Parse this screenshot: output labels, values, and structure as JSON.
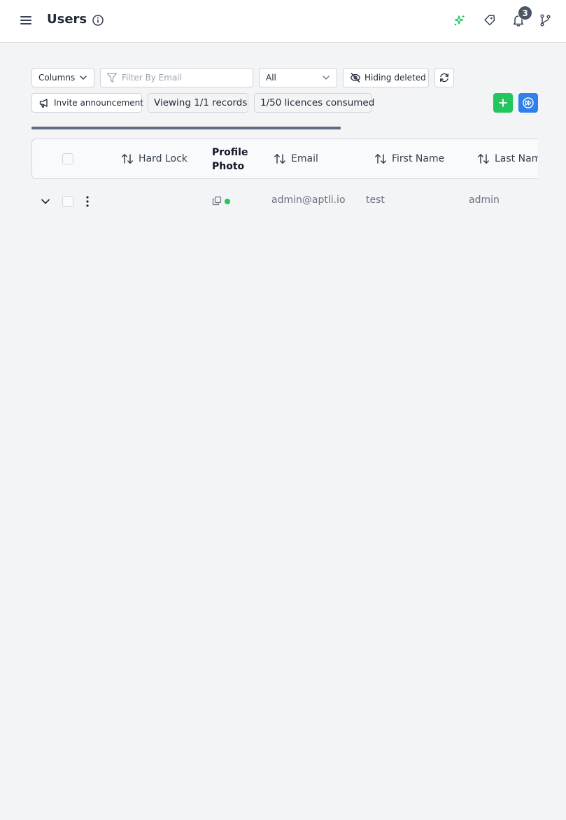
{
  "header": {
    "title": "Users",
    "icons": [
      "menu-icon",
      "info-icon",
      "sparkle-icon",
      "tag-icon",
      "bell-icon",
      "git-branch-icon"
    ],
    "notification_count": "3",
    "accent_green": "#22c55e"
  },
  "toolbar": {
    "columns_label": "Columns",
    "filter_placeholder": "Filter By Email",
    "scope_select_value": "All",
    "hiding_deleted_label": "Hiding deleted",
    "invite_announcement_label": "Invite announcement",
    "viewing_records": "Viewing 1/1 records",
    "licences_consumed": "1/50 licences consumed",
    "add_color": "#22c55e",
    "fast_forward_color": "#2f80ed"
  },
  "progress": {
    "fraction": 0.61
  },
  "table": {
    "columns": {
      "hard_lock": "Hard Lock",
      "profile_photo_line1": "Profile",
      "profile_photo_line2": "Photo",
      "email": "Email",
      "first_name": "First Name",
      "last_name": "Last Name"
    },
    "rows": [
      {
        "email": "admin@aptli.io",
        "first_name": "test",
        "last_name": "admin",
        "status": "online"
      }
    ]
  }
}
